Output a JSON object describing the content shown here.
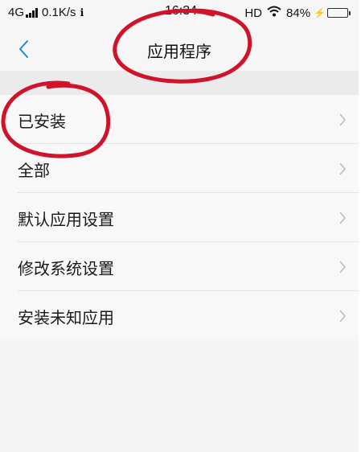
{
  "status_bar": {
    "network": "4G",
    "speed": "0.1K/s",
    "extra_icon": "ℹ",
    "time": "16:34",
    "hd": "HD",
    "battery_percent": "84%",
    "battery_level": 0.84,
    "battery_color": "#39c340"
  },
  "header": {
    "title": "应用程序",
    "back_icon": "chevron-left-icon",
    "accent_color": "#1a8cd8"
  },
  "list": {
    "items": [
      {
        "label": "已安装"
      },
      {
        "label": "全部"
      },
      {
        "label": "默认应用设置"
      },
      {
        "label": "修改系统设置"
      },
      {
        "label": "安装未知应用"
      }
    ]
  },
  "annotation_color": "#d0122a"
}
